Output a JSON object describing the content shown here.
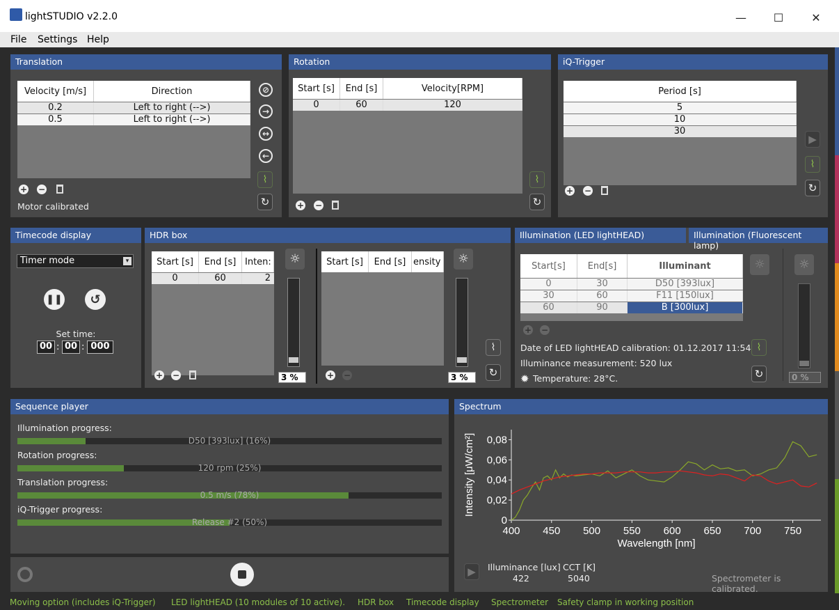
{
  "window": {
    "title": "lightSTUDIO v2.2.0",
    "minimize": "—",
    "maximize": "☐",
    "close": "✕"
  },
  "menu": [
    "File",
    "Settings",
    "Help"
  ],
  "translation": {
    "title": "Translation",
    "columns": [
      "Velocity [m/s]",
      "Direction"
    ],
    "rows": [
      [
        "0.2",
        "Left to right (-->)"
      ],
      [
        "0.5",
        "Left to right (-->)"
      ]
    ],
    "status": "Motor calibrated"
  },
  "rotation": {
    "title": "Rotation",
    "columns": [
      "Start [s]",
      "End [s]",
      "Velocity[RPM]"
    ],
    "rows": [
      [
        "0",
        "60",
        "120"
      ]
    ]
  },
  "iq_trigger": {
    "title": "iQ-Trigger",
    "columns": [
      "Period [s]"
    ],
    "rows": [
      [
        "5"
      ],
      [
        "10"
      ],
      [
        "30"
      ]
    ]
  },
  "timecode": {
    "title": "Timecode display",
    "mode": "Timer mode",
    "set_time_label": "Set time:",
    "time": [
      "00",
      "00",
      "000"
    ]
  },
  "hdr": {
    "title": "HDR box",
    "left_columns": [
      "Start [s]",
      "End [s]",
      "Inten:"
    ],
    "left_rows": [
      [
        "0",
        "60",
        "2"
      ]
    ],
    "right_columns": [
      "Start [s]",
      "End [s]",
      "ensity"
    ],
    "left_value": "3 %",
    "right_value": "3 %",
    "left_level": 0.03,
    "right_level": 0.03
  },
  "illum_led": {
    "title": "Illumination (LED lightHEAD)",
    "columns": [
      "Start[s]",
      "End[s]",
      "Illuminant"
    ],
    "rows": [
      [
        "0",
        "30",
        "D50 [393lux]"
      ],
      [
        "30",
        "60",
        "F11 [150lux]"
      ],
      [
        "60",
        "90",
        "B [300lux]"
      ]
    ],
    "calibration": "Date of LED lightHEAD calibration: 01.12.2017 11:54",
    "illuminance": "Illuminance measurement: 520 lux",
    "temperature": "Temperature: 28°C."
  },
  "illum_fluor": {
    "title": "Illumination (Fluorescent lamp)",
    "value": "0 %",
    "level": 0.0
  },
  "sequence": {
    "title": "Sequence player",
    "items": [
      {
        "label": "Illumination progress:",
        "text": "D50 [393lux] (16%)",
        "value": 0.16
      },
      {
        "label": "Rotation progress:",
        "text": "120 rpm (25%)",
        "value": 0.25
      },
      {
        "label": "Translation progress:",
        "text": "0.5 m/s (78%)",
        "value": 0.78
      },
      {
        "label": "iQ-Trigger progress:",
        "text": "Release #2 (50%)",
        "value": 0.5
      }
    ]
  },
  "spectrum": {
    "title": "Spectrum",
    "illuminance_label": "Illuminance [lux]",
    "illuminance_value": "422",
    "cct_label": "CCT [K]",
    "cct_value": "5040",
    "status": "Spectrometer is calibrated."
  },
  "chart_data": {
    "type": "line",
    "xlabel": "Wavelength [nm]",
    "ylabel": "Intensity [μW/cm²]",
    "xticks": [
      "400",
      "450",
      "500",
      "550",
      "600",
      "650",
      "700",
      "750"
    ],
    "yticks": [
      "0",
      "0,02",
      "0,04",
      "0,06",
      "0,08"
    ],
    "xlim": [
      400,
      785
    ],
    "ylim": [
      0,
      0.09
    ],
    "series": [
      {
        "color": "#8aa82a",
        "x": [
          400,
          405,
          410,
          415,
          420,
          425,
          430,
          435,
          440,
          445,
          450,
          455,
          460,
          465,
          470,
          475,
          480,
          490,
          500,
          510,
          520,
          530,
          540,
          550,
          560,
          570,
          580,
          590,
          600,
          610,
          620,
          630,
          640,
          650,
          660,
          670,
          680,
          690,
          700,
          710,
          720,
          730,
          740,
          750,
          760,
          770,
          780
        ],
        "y": [
          0.0,
          0.003,
          0.01,
          0.02,
          0.025,
          0.032,
          0.038,
          0.03,
          0.042,
          0.044,
          0.04,
          0.05,
          0.042,
          0.046,
          0.043,
          0.045,
          0.044,
          0.045,
          0.046,
          0.044,
          0.049,
          0.042,
          0.046,
          0.05,
          0.044,
          0.04,
          0.039,
          0.038,
          0.043,
          0.05,
          0.058,
          0.056,
          0.05,
          0.055,
          0.051,
          0.052,
          0.049,
          0.05,
          0.044,
          0.046,
          0.05,
          0.052,
          0.062,
          0.078,
          0.074,
          0.063,
          0.065
        ]
      },
      {
        "color": "#e02020",
        "x": [
          400,
          410,
          420,
          430,
          440,
          450,
          460,
          470,
          480,
          490,
          500,
          510,
          520,
          530,
          540,
          550,
          560,
          570,
          580,
          590,
          600,
          610,
          620,
          630,
          640,
          650,
          660,
          670,
          680,
          690,
          700,
          710,
          720,
          730,
          740,
          750,
          760,
          770,
          780
        ],
        "y": [
          0.026,
          0.03,
          0.033,
          0.036,
          0.039,
          0.041,
          0.043,
          0.044,
          0.045,
          0.046,
          0.046,
          0.047,
          0.047,
          0.047,
          0.048,
          0.048,
          0.048,
          0.047,
          0.047,
          0.048,
          0.048,
          0.049,
          0.048,
          0.047,
          0.045,
          0.044,
          0.046,
          0.045,
          0.042,
          0.039,
          0.045,
          0.044,
          0.039,
          0.036,
          0.038,
          0.04,
          0.034,
          0.033,
          0.037
        ]
      }
    ]
  },
  "statusbar": [
    "Moving option (includes iQ-Trigger)",
    "LED lightHEAD (10 modules of 10 active).",
    "HDR box",
    "Timecode display",
    "Spectrometer",
    "Safety clamp in working position"
  ],
  "colors": {
    "panel_header": "#3a5b97",
    "progress": "#5a8a3a",
    "status_text": "#8cc04a"
  }
}
